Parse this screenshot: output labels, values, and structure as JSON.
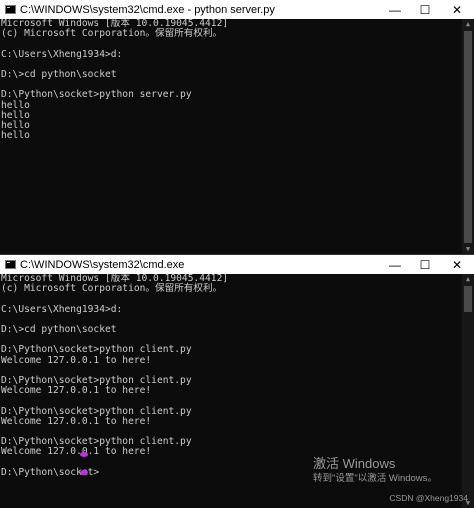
{
  "window1": {
    "title": "C:\\WINDOWS\\system32\\cmd.exe - python  server.py",
    "lines": "Microsoft Windows [版本 10.0.19045.4412]\n(c) Microsoft Corporation。保留所有权利。\n\nC:\\Users\\Xheng1934>d:\n\nD:\\>cd python\\socket\n\nD:\\Python\\socket>python server.py\nhello\nhello\nhello\nhello"
  },
  "window2": {
    "title": "C:\\WINDOWS\\system32\\cmd.exe",
    "lines": "Microsoft Windows [版本 10.0.19045.4412]\n(c) Microsoft Corporation。保留所有权利。\n\nC:\\Users\\Xheng1934>d:\n\nD:\\>cd python\\socket\n\nD:\\Python\\socket>python client.py\nWelcome 127.0.0.1 to here!\n\nD:\\Python\\socket>python client.py\nWelcome 127.0.0.1 to here!\n\nD:\\Python\\socket>python client.py\nWelcome 127.0.0.1 to here!\n\nD:\\Python\\socket>python client.py\nWelcome 127.0.0.1 to here!\n\nD:\\Python\\socket>"
  },
  "controls": {
    "minimize": "—",
    "maximize": "☐",
    "close": "✕"
  },
  "scroll": {
    "up": "▲",
    "down": "▼"
  },
  "activation": {
    "line1": "激活 Windows",
    "line2": "转到\"设置\"以激活 Windows。"
  },
  "watermark": "CSDN @Xheng1934",
  "colors": {
    "console_bg": "#0c0c0c",
    "console_fg": "#cccccc",
    "cursor_mark": "#c030e0"
  }
}
